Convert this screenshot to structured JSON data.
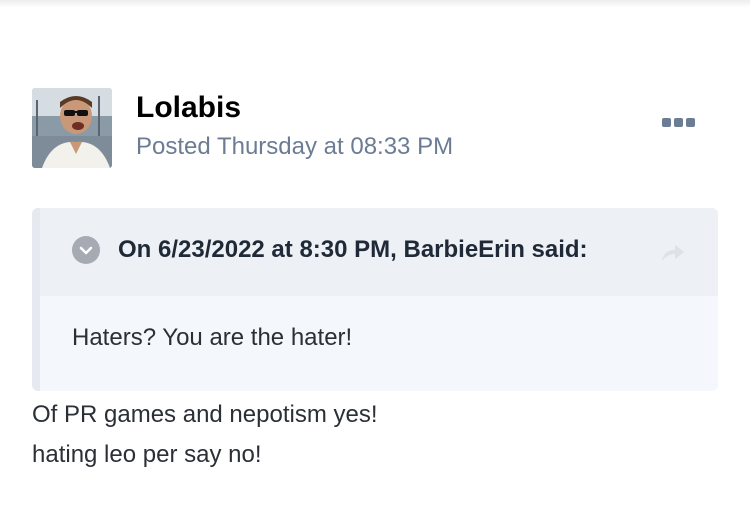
{
  "post": {
    "author": "Lolabis",
    "posted": "Posted Thursday at 08:33 PM",
    "more_icon": "more-dots-icon",
    "quote": {
      "citation": "On 6/23/2022 at 8:30 PM, BarbieErin said:",
      "text": "Haters? You are the hater!",
      "toggle_icon": "chevron-down-circle-icon",
      "share_icon": "share-arrow-icon"
    },
    "body": [
      "Of PR games and nepotism yes!",
      "hating leo per say no!"
    ]
  },
  "colors": {
    "meta": "#6b7c93",
    "quote_bg": "#f4f7fb",
    "quote_head_bg": "#edf0f4",
    "quote_bar": "#e6eaf0",
    "text": "#2b2f36"
  }
}
